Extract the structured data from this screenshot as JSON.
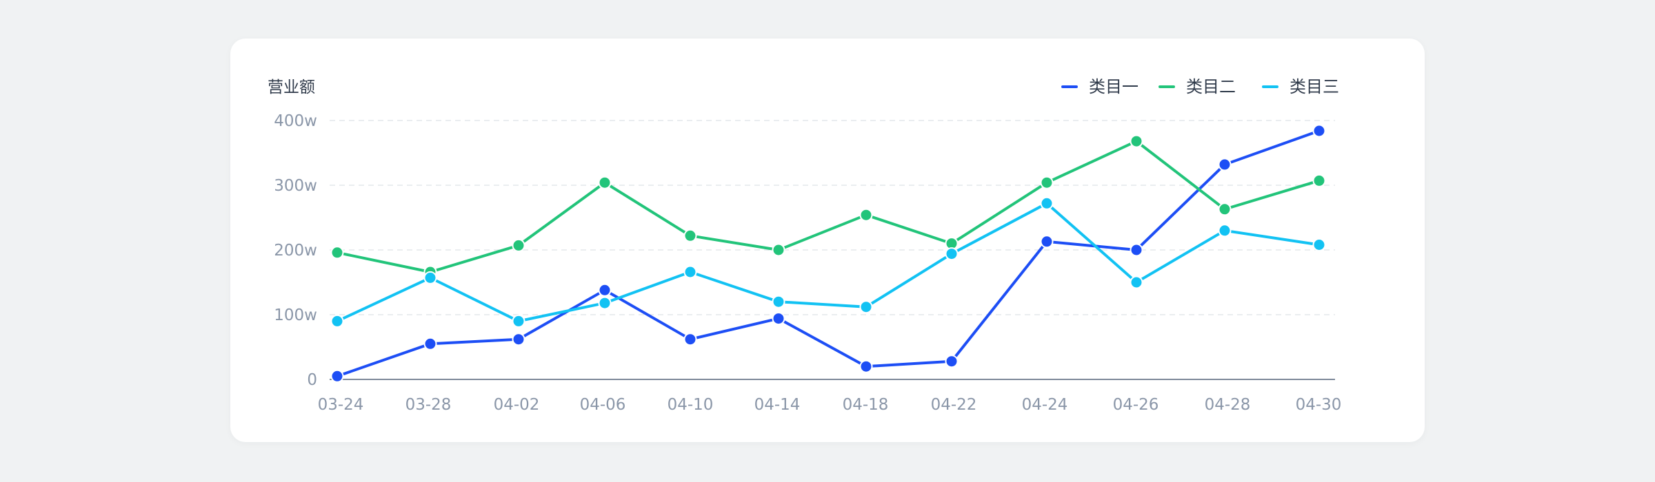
{
  "chart_data": {
    "type": "line",
    "ylabel": "营业额",
    "categories": [
      "03-24",
      "03-28",
      "04-02",
      "04-06",
      "04-10",
      "04-14",
      "04-18",
      "04-22",
      "04-24",
      "04-26",
      "04-28",
      "04-30"
    ],
    "y_ticks": [
      "0",
      "100w",
      "200w",
      "300w",
      "400w"
    ],
    "ylim": [
      0,
      400
    ],
    "grid": true,
    "legend_position": "top-right",
    "series": [
      {
        "name": "类目一",
        "color": "#1d4ef5",
        "values": [
          5,
          55,
          62,
          138,
          62,
          94,
          20,
          28,
          213,
          200,
          332,
          384
        ]
      },
      {
        "name": "类目二",
        "color": "#22c47a",
        "values": [
          196,
          166,
          207,
          304,
          222,
          200,
          254,
          210,
          304,
          368,
          263,
          307
        ]
      },
      {
        "name": "类目三",
        "color": "#12c2f3",
        "values": [
          90,
          157,
          90,
          118,
          166,
          120,
          112,
          194,
          272,
          150,
          230,
          208
        ]
      }
    ]
  }
}
